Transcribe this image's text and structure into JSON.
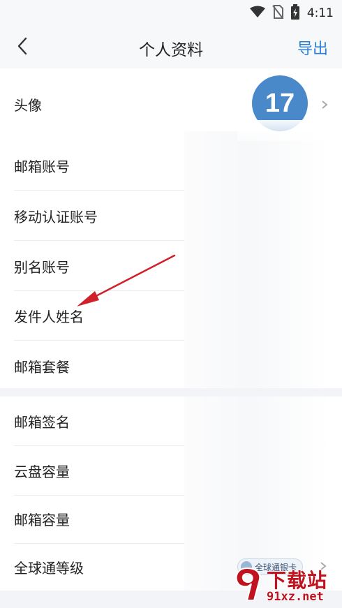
{
  "status_bar": {
    "time": "4:11",
    "icons": [
      "wifi-icon",
      "no-sim-icon",
      "battery-charging-icon"
    ]
  },
  "header": {
    "back_icon": "chevron-left-icon",
    "title": "个人资料",
    "export_label": "导出",
    "accent_color": "#2a7fd5"
  },
  "profile": {
    "avatar_label": "头像",
    "avatar_text": "17",
    "avatar_color": "#4a89c9"
  },
  "account_section": {
    "rows": [
      {
        "label": "邮箱账号"
      },
      {
        "label": "移动认证账号"
      },
      {
        "label": "别名账号"
      },
      {
        "label": "发件人姓名"
      },
      {
        "label": "邮箱套餐"
      }
    ]
  },
  "settings_section": {
    "rows": [
      {
        "label": "邮箱签名"
      },
      {
        "label": "云盘容量"
      },
      {
        "label": "邮箱容量"
      },
      {
        "label": "全球通等级",
        "badge": "全球通银卡"
      }
    ]
  },
  "annotation": {
    "arrow_color": "#d0202a"
  },
  "watermark": {
    "title": "下载站",
    "url": "91xz.net",
    "brand_color": "#c0121f"
  }
}
